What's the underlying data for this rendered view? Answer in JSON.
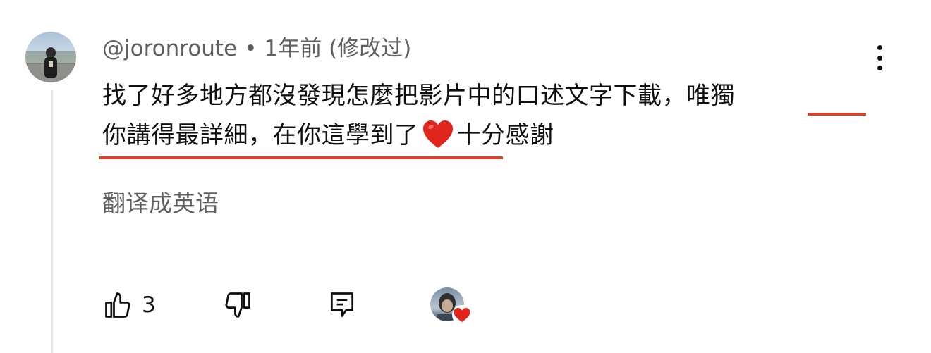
{
  "comment": {
    "author": "@joronroute",
    "separator": "•",
    "time": "1年前",
    "edited": "(修改过)",
    "text_line1": "找了好多地方都沒發現怎麼把影片中的口述文字下載，唯獨",
    "text_line2_a": "你講得最詳細，在你這學到了",
    "emoji": "red-heart-emoji",
    "text_line2_b": "十分感謝",
    "underline_color": "#d6442a"
  },
  "translate_label": "翻译成英语",
  "actions": {
    "like_count": "3",
    "like_icon": "thumb-up-icon",
    "dislike_icon": "thumb-down-icon",
    "reply_icon": "comment-icon",
    "creator_heart_icon": "creator-heart-icon"
  },
  "menu_icon": "more-vertical-icon",
  "colors": {
    "text": "#0f0f0f",
    "secondary_text": "#606060",
    "heart": "#e0261c",
    "thread_line": "#e6e6e6"
  }
}
